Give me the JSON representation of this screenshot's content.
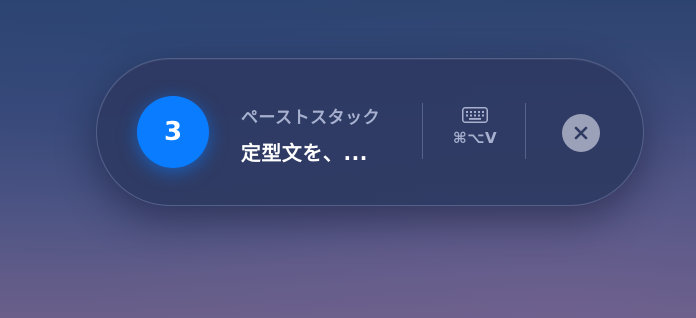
{
  "paste_stack": {
    "count": "3",
    "title": "ペーストスタック",
    "preview": "定型文を、...",
    "shortcut": "⌘⌥V",
    "keyboard_icon": "keyboard-icon",
    "close_icon": "close-icon"
  },
  "colors": {
    "badge": "#0a7cff",
    "pill_background": "#2e3a62",
    "secondary_text": "#a7b0cf",
    "close_button": "#9aa1b8"
  }
}
